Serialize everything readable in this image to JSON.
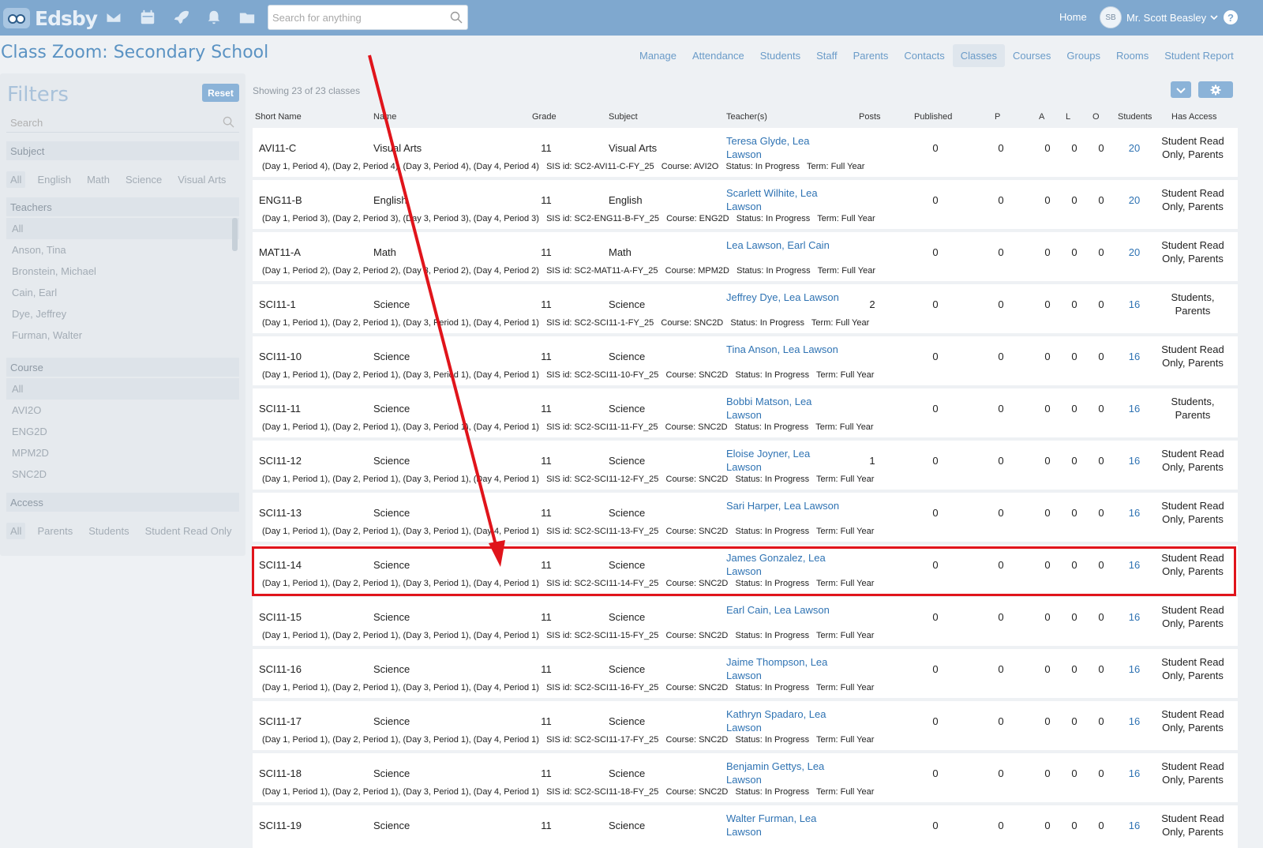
{
  "app": {
    "logo_text": "Edsby",
    "search_placeholder": "Search for anything",
    "home_label": "Home",
    "user_initials": "SB",
    "user_name": "Mr. Scott Beasley",
    "help_label": "?"
  },
  "page": {
    "title": "Class Zoom: Secondary School",
    "nav": [
      "Manage",
      "Attendance",
      "Students",
      "Staff",
      "Parents",
      "Contacts",
      "Classes",
      "Courses",
      "Groups",
      "Rooms",
      "Student Report"
    ],
    "active_nav": "Classes"
  },
  "filters": {
    "title": "Filters",
    "reset_label": "Reset",
    "search_placeholder": "Search",
    "subject": {
      "heading": "Subject",
      "options": [
        "All",
        "English",
        "Math",
        "Science",
        "Visual Arts"
      ]
    },
    "teachers": {
      "heading": "Teachers",
      "options": [
        "All",
        "Anson, Tina",
        "Bronstein, Michael",
        "Cain, Earl",
        "Dye, Jeffrey",
        "Furman, Walter"
      ]
    },
    "course": {
      "heading": "Course",
      "options": [
        "All",
        "AVI2O",
        "ENG2D",
        "MPM2D",
        "SNC2D"
      ]
    },
    "access": {
      "heading": "Access",
      "options": [
        "All",
        "Parents",
        "Students",
        "Student Read Only"
      ]
    }
  },
  "table": {
    "showing": "Showing 23 of 23 classes",
    "headers": [
      "Short Name",
      "Name",
      "Grade",
      "Subject",
      "Teacher(s)",
      "Posts",
      "Published",
      "P",
      "A",
      "L",
      "O",
      "Students",
      "Has Access"
    ],
    "rows": [
      {
        "short": "AVI11-C",
        "name": "Visual Arts",
        "grade": "11",
        "subject": "Visual Arts",
        "teachers": "Teresa Glyde, Lea Lawson",
        "posts": "",
        "published": "0",
        "p": "0",
        "a": "0",
        "l": "0",
        "o": "0",
        "students": "20",
        "access": "Student Read Only, Parents",
        "detail": "(Day 1, Period 4), (Day 2, Period 4), (Day 3, Period 4), (Day 4, Period 4)   SIS id: SC2-AVI11-C-FY_25   Course: AVI2O   Status: In Progress   Term: Full Year"
      },
      {
        "short": "ENG11-B",
        "name": "English",
        "grade": "11",
        "subject": "English",
        "teachers": "Scarlett Wilhite, Lea Lawson",
        "posts": "",
        "published": "0",
        "p": "0",
        "a": "0",
        "l": "0",
        "o": "0",
        "students": "20",
        "access": "Student Read Only, Parents",
        "detail": "(Day 1, Period 3), (Day 2, Period 3), (Day 3, Period 3), (Day 4, Period 3)   SIS id: SC2-ENG11-B-FY_25   Course: ENG2D   Status: In Progress   Term: Full Year"
      },
      {
        "short": "MAT11-A",
        "name": "Math",
        "grade": "11",
        "subject": "Math",
        "teachers": "Lea Lawson, Earl Cain",
        "posts": "",
        "published": "0",
        "p": "0",
        "a": "0",
        "l": "0",
        "o": "0",
        "students": "20",
        "access": "Student Read Only, Parents",
        "detail": "(Day 1, Period 2), (Day 2, Period 2), (Day 3, Period 2), (Day 4, Period 2)   SIS id: SC2-MAT11-A-FY_25   Course: MPM2D   Status: In Progress   Term: Full Year"
      },
      {
        "short": "SCI11-1",
        "name": "Science",
        "grade": "11",
        "subject": "Science",
        "teachers": "Jeffrey Dye, Lea Lawson",
        "posts": "2",
        "published": "0",
        "p": "0",
        "a": "0",
        "l": "0",
        "o": "0",
        "students": "16",
        "access": "Students, Parents",
        "detail": "(Day 1, Period 1), (Day 2, Period 1), (Day 3, Period 1), (Day 4, Period 1)   SIS id: SC2-SCI11-1-FY_25   Course: SNC2D   Status: In Progress   Term: Full Year"
      },
      {
        "short": "SCI11-10",
        "name": "Science",
        "grade": "11",
        "subject": "Science",
        "teachers": "Tina Anson, Lea Lawson",
        "posts": "",
        "published": "0",
        "p": "0",
        "a": "0",
        "l": "0",
        "o": "0",
        "students": "16",
        "access": "Student Read Only, Parents",
        "detail": "(Day 1, Period 1), (Day 2, Period 1), (Day 3, Period 1), (Day 4, Period 1)   SIS id: SC2-SCI11-10-FY_25   Course: SNC2D   Status: In Progress   Term: Full Year"
      },
      {
        "short": "SCI11-11",
        "name": "Science",
        "grade": "11",
        "subject": "Science",
        "teachers": "Bobbi Matson, Lea Lawson",
        "posts": "",
        "published": "0",
        "p": "0",
        "a": "0",
        "l": "0",
        "o": "0",
        "students": "16",
        "access": "Students, Parents",
        "detail": "(Day 1, Period 1), (Day 2, Period 1), (Day 3, Period 1), (Day 4, Period 1)   SIS id: SC2-SCI11-11-FY_25   Course: SNC2D   Status: In Progress   Term: Full Year"
      },
      {
        "short": "SCI11-12",
        "name": "Science",
        "grade": "11",
        "subject": "Science",
        "teachers": "Eloise Joyner, Lea Lawson",
        "posts": "1",
        "published": "0",
        "p": "0",
        "a": "0",
        "l": "0",
        "o": "0",
        "students": "16",
        "access": "Student Read Only, Parents",
        "detail": "(Day 1, Period 1), (Day 2, Period 1), (Day 3, Period 1), (Day 4, Period 1)   SIS id: SC2-SCI11-12-FY_25   Course: SNC2D   Status: In Progress   Term: Full Year"
      },
      {
        "short": "SCI11-13",
        "name": "Science",
        "grade": "11",
        "subject": "Science",
        "teachers": "Sari Harper, Lea Lawson",
        "posts": "",
        "published": "0",
        "p": "0",
        "a": "0",
        "l": "0",
        "o": "0",
        "students": "16",
        "access": "Student Read Only, Parents",
        "detail": "(Day 1, Period 1), (Day 2, Period 1), (Day 3, Period 1), (Day 4, Period 1)   SIS id: SC2-SCI11-13-FY_25   Course: SNC2D   Status: In Progress   Term: Full Year"
      },
      {
        "short": "SCI11-14",
        "name": "Science",
        "grade": "11",
        "subject": "Science",
        "teachers": "James Gonzalez, Lea Lawson",
        "posts": "",
        "published": "0",
        "p": "0",
        "a": "0",
        "l": "0",
        "o": "0",
        "students": "16",
        "access": "Student Read Only, Parents",
        "detail": "(Day 1, Period 1), (Day 2, Period 1), (Day 3, Period 1), (Day 4, Period 1)   SIS id: SC2-SCI11-14-FY_25   Course: SNC2D   Status: In Progress   Term: Full Year"
      },
      {
        "short": "SCI11-15",
        "name": "Science",
        "grade": "11",
        "subject": "Science",
        "teachers": "Earl Cain, Lea Lawson",
        "posts": "",
        "published": "0",
        "p": "0",
        "a": "0",
        "l": "0",
        "o": "0",
        "students": "16",
        "access": "Student Read Only, Parents",
        "detail": "(Day 1, Period 1), (Day 2, Period 1), (Day 3, Period 1), (Day 4, Period 1)   SIS id: SC2-SCI11-15-FY_25   Course: SNC2D   Status: In Progress   Term: Full Year"
      },
      {
        "short": "SCI11-16",
        "name": "Science",
        "grade": "11",
        "subject": "Science",
        "teachers": "Jaime Thompson, Lea Lawson",
        "posts": "",
        "published": "0",
        "p": "0",
        "a": "0",
        "l": "0",
        "o": "0",
        "students": "16",
        "access": "Student Read Only, Parents",
        "detail": "(Day 1, Period 1), (Day 2, Period 1), (Day 3, Period 1), (Day 4, Period 1)   SIS id: SC2-SCI11-16-FY_25   Course: SNC2D   Status: In Progress   Term: Full Year"
      },
      {
        "short": "SCI11-17",
        "name": "Science",
        "grade": "11",
        "subject": "Science",
        "teachers": "Kathryn Spadaro, Lea Lawson",
        "posts": "",
        "published": "0",
        "p": "0",
        "a": "0",
        "l": "0",
        "o": "0",
        "students": "16",
        "access": "Student Read Only, Parents",
        "detail": "(Day 1, Period 1), (Day 2, Period 1), (Day 3, Period 1), (Day 4, Period 1)   SIS id: SC2-SCI11-17-FY_25   Course: SNC2D   Status: In Progress   Term: Full Year"
      },
      {
        "short": "SCI11-18",
        "name": "Science",
        "grade": "11",
        "subject": "Science",
        "teachers": "Benjamin Gettys, Lea Lawson",
        "posts": "",
        "published": "0",
        "p": "0",
        "a": "0",
        "l": "0",
        "o": "0",
        "students": "16",
        "access": "Student Read Only, Parents",
        "detail": "(Day 1, Period 1), (Day 2, Period 1), (Day 3, Period 1), (Day 4, Period 1)   SIS id: SC2-SCI11-18-FY_25   Course: SNC2D   Status: In Progress   Term: Full Year"
      },
      {
        "short": "SCI11-19",
        "name": "Science",
        "grade": "11",
        "subject": "Science",
        "teachers": "Walter Furman, Lea Lawson",
        "posts": "",
        "published": "0",
        "p": "0",
        "a": "0",
        "l": "0",
        "o": "0",
        "students": "16",
        "access": "Student Read Only, Parents",
        "detail": ""
      }
    ]
  },
  "annotation": {
    "highlighted_row": "SCI11-14",
    "color": "#e0141b"
  }
}
